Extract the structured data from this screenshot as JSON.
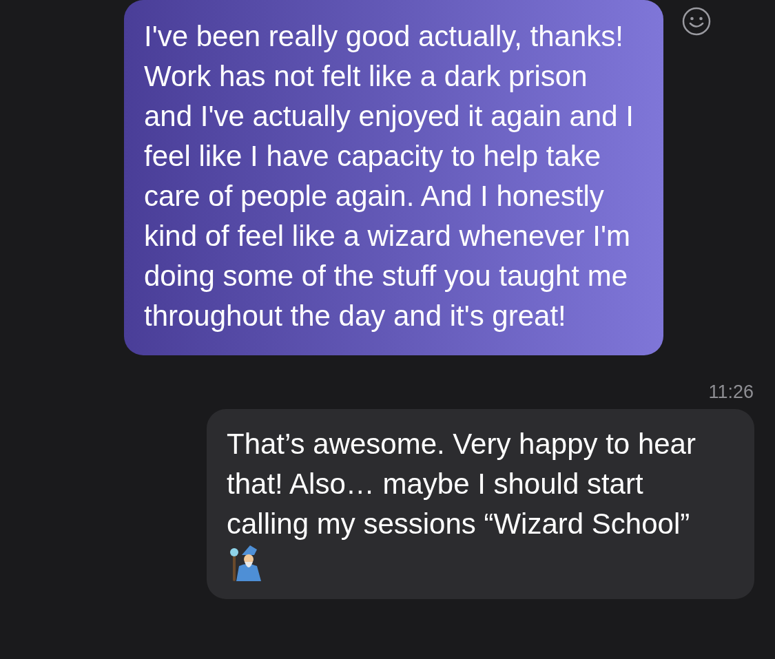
{
  "messages": [
    {
      "kind": "received",
      "text": "I've been really good actually, thanks! Work has not felt like a dark prison and I've actually enjoyed it again and I feel like I have capacity to help take care of people again. And I honestly kind of feel like a wizard whenever I'm doing some of the stuff you taught me throughout the day and it's great!"
    },
    {
      "kind": "timestamp",
      "text": "11:26"
    },
    {
      "kind": "sent",
      "text": "That’s awesome. Very happy to hear that! Also… maybe I should start calling my sessions “Wizard School”"
    }
  ]
}
